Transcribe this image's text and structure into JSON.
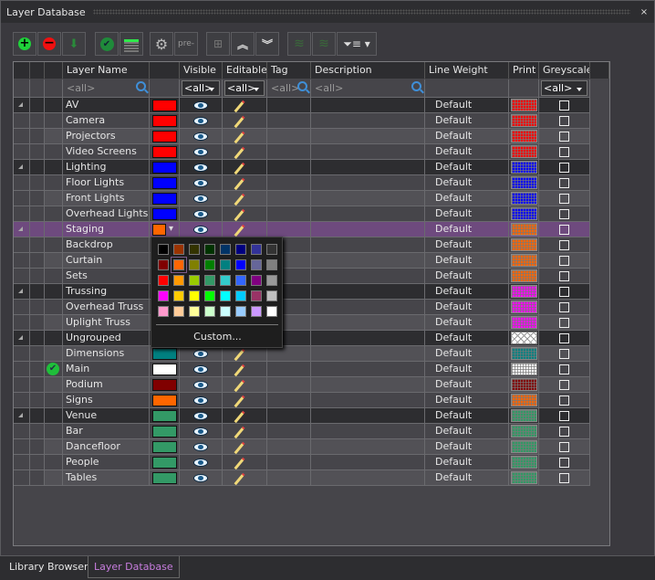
{
  "window": {
    "title": "Layer Database",
    "close": "×"
  },
  "toolbar": [
    {
      "name": "add-layer-button",
      "icon": "plus-circle-icon",
      "label": ""
    },
    {
      "name": "delete-layer-button",
      "icon": "minus-circle-icon",
      "label": ""
    },
    {
      "name": "merge-layers-button",
      "icon": "merge-down-icon",
      "label": ""
    },
    {
      "name": "set-active-button",
      "icon": "check-circle-icon",
      "label": ""
    },
    {
      "name": "layer-states-button",
      "icon": "layers-list-icon",
      "label": ""
    },
    {
      "name": "settings-button",
      "icon": "gear-icon",
      "label": ""
    },
    {
      "name": "prefix-button",
      "icon": "prefix-icon",
      "label": "pre-"
    },
    {
      "name": "add-group-button",
      "icon": "tree-add-icon",
      "label": ""
    },
    {
      "name": "collapse-all-button",
      "icon": "chevrons-up-icon",
      "label": ""
    },
    {
      "name": "expand-all-button",
      "icon": "chevrons-down-icon",
      "label": ""
    },
    {
      "name": "layer-stack-button",
      "icon": "layer-stack-icon",
      "label": ""
    },
    {
      "name": "add-layer-stack-button",
      "icon": "layer-stack-add-icon",
      "label": ""
    },
    {
      "name": "filter-button",
      "icon": "filter-icon",
      "label": ""
    }
  ],
  "columns": {
    "name": "Layer Name",
    "visible": "Visible",
    "editable": "Editable",
    "tag": "Tag",
    "description": "Description",
    "line_weight": "Line Weight",
    "print": "Print",
    "greyscale": "Greyscale"
  },
  "filters": {
    "name": "<all>",
    "visible": "<all>",
    "editable": "<all>",
    "tag": "<all>",
    "description": "<all>",
    "greyscale": "<all>"
  },
  "rows": [
    {
      "name": "AV",
      "group": true,
      "color": "#ff0000",
      "lw": "Default"
    },
    {
      "name": "Camera",
      "color": "#ff0000",
      "lw": "Default"
    },
    {
      "name": "Projectors",
      "color": "#ff0000",
      "lw": "Default"
    },
    {
      "name": "Video Screens",
      "color": "#ff0000",
      "lw": "Default"
    },
    {
      "name": "Lighting",
      "group": true,
      "color": "#0000ff",
      "lw": "Default"
    },
    {
      "name": "Floor Lights",
      "color": "#0000ff",
      "lw": "Default"
    },
    {
      "name": "Front Lights",
      "color": "#0000ff",
      "lw": "Default"
    },
    {
      "name": "Overhead Lights",
      "color": "#0000ff",
      "lw": "Default"
    },
    {
      "name": "Staging",
      "group": true,
      "selected": true,
      "color": "#ff6600",
      "lw": "Default"
    },
    {
      "name": "Backdrop",
      "color": "#ff6600",
      "lw": "Default"
    },
    {
      "name": "Curtain",
      "color": "#ff6600",
      "lw": "Default"
    },
    {
      "name": "Sets",
      "color": "#ff6600",
      "lw": "Default"
    },
    {
      "name": "Trussing",
      "group": true,
      "color": "#ff00ff",
      "lw": "Default"
    },
    {
      "name": "Overhead Truss",
      "color": "#ff00ff",
      "lw": "Default"
    },
    {
      "name": "Uplight Truss",
      "color": "#ff00ff",
      "lw": "Default"
    },
    {
      "name": "Ungrouped",
      "group": true,
      "color": "#ffffff",
      "lw": "Default",
      "hatch": true
    },
    {
      "name": "Dimensions",
      "color": "#008080",
      "lw": "Default"
    },
    {
      "name": "Main",
      "color": "#ffffff",
      "lw": "Default",
      "active": true
    },
    {
      "name": "Podium",
      "color": "#800000",
      "lw": "Default"
    },
    {
      "name": "Signs",
      "color": "#ff6600",
      "lw": "Default"
    },
    {
      "name": "Venue",
      "group": true,
      "color": "#339966",
      "lw": "Default"
    },
    {
      "name": "Bar",
      "color": "#339966",
      "lw": "Default"
    },
    {
      "name": "Dancefloor",
      "color": "#339966",
      "lw": "Default"
    },
    {
      "name": "People",
      "color": "#339966",
      "lw": "Default"
    },
    {
      "name": "Tables",
      "color": "#339966",
      "lw": "Default"
    }
  ],
  "color_picker": {
    "swatches": [
      "#000000",
      "#993300",
      "#333300",
      "#003300",
      "#003366",
      "#000080",
      "#333399",
      "#333333",
      "#800000",
      "#ff6600",
      "#808000",
      "#008000",
      "#008080",
      "#0000ff",
      "#666699",
      "#808080",
      "#ff0000",
      "#ff9900",
      "#99cc00",
      "#339966",
      "#33cccc",
      "#3366ff",
      "#800080",
      "#999999",
      "#ff00ff",
      "#ffcc00",
      "#ffff00",
      "#00ff00",
      "#00ffff",
      "#00ccff",
      "#993366",
      "#c0c0c0",
      "#ff99cc",
      "#ffcc99",
      "#ffff99",
      "#ccffcc",
      "#ccffff",
      "#99ccff",
      "#cc99ff",
      "#ffffff"
    ],
    "selected": "#ff6600",
    "custom_label": "Custom..."
  },
  "tabs": [
    {
      "label": "Library Browser",
      "active": false
    },
    {
      "label": "Layer Database",
      "active": true
    }
  ],
  "colors": {
    "accent": "#c77dde",
    "selected_row": "#6e4a7e"
  }
}
